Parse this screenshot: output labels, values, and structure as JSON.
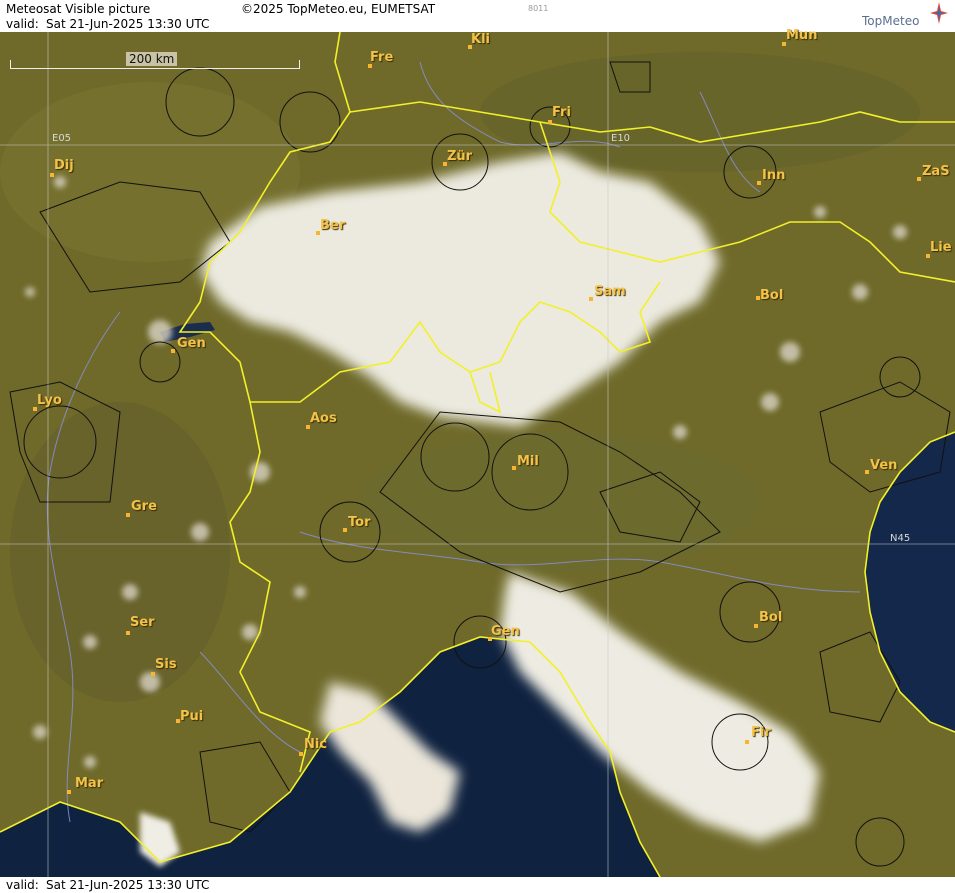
{
  "header": {
    "title": "Meteosat Visible picture",
    "copyright": "©2025 TopMeteo.eu, EUMETSAT",
    "valid_label": "valid:",
    "valid_time": "Sat  21-Jun-2025  13:30 UTC",
    "code": "8011",
    "logo": "TopMeteo"
  },
  "footer": {
    "valid_label": "valid:",
    "valid_time": "Sat  21-Jun-2025  13:30 UTC"
  },
  "scale_bar": "200 km",
  "grid_labels": [
    "E05",
    "E10",
    "N45"
  ],
  "cities": [
    {
      "id": "kli",
      "label": "Kli"
    },
    {
      "id": "mun",
      "label": "Mun"
    },
    {
      "id": "fre",
      "label": "Fre"
    },
    {
      "id": "fri",
      "label": "Fri"
    },
    {
      "id": "dij",
      "label": "Dij"
    },
    {
      "id": "zur",
      "label": "Zür"
    },
    {
      "id": "inn",
      "label": "Inn"
    },
    {
      "id": "zas",
      "label": "ZaS"
    },
    {
      "id": "ber",
      "label": "Ber"
    },
    {
      "id": "lie",
      "label": "Lie"
    },
    {
      "id": "sam",
      "label": "Sam"
    },
    {
      "id": "bol1",
      "label": "Bol"
    },
    {
      "id": "gen1",
      "label": "Gen"
    },
    {
      "id": "lyo",
      "label": "Lyo"
    },
    {
      "id": "aos",
      "label": "Aos"
    },
    {
      "id": "mil",
      "label": "Mil"
    },
    {
      "id": "ven",
      "label": "Ven"
    },
    {
      "id": "gre",
      "label": "Gre"
    },
    {
      "id": "tor",
      "label": "Tor"
    },
    {
      "id": "ser",
      "label": "Ser"
    },
    {
      "id": "bol2",
      "label": "Bol"
    },
    {
      "id": "gen2",
      "label": "Gen"
    },
    {
      "id": "sis",
      "label": "Sis"
    },
    {
      "id": "pui",
      "label": "Pui"
    },
    {
      "id": "nic",
      "label": "Nic"
    },
    {
      "id": "fir",
      "label": "Fir"
    },
    {
      "id": "mar",
      "label": "Mar"
    }
  ],
  "colors": {
    "land": "#6f6a2a",
    "sea": "#0f2240",
    "cloud": "#eceadf",
    "border": "#f2f02a",
    "city": "#f2c24a",
    "airspace": "#111111",
    "river": "#8a8fd8"
  }
}
